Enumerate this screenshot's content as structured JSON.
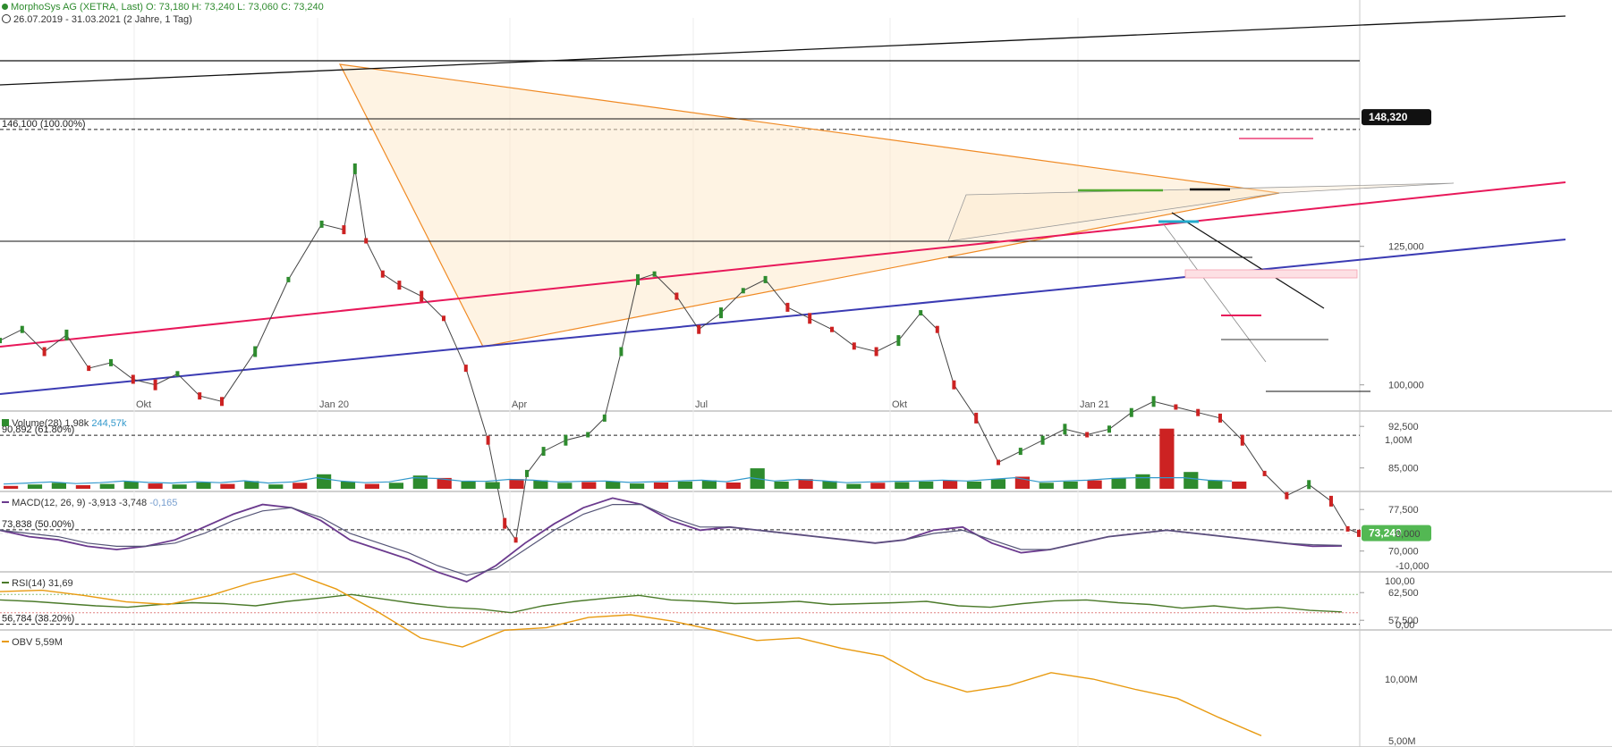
{
  "header": {
    "title_line": "MorphoSys AG (XETRA, Last)  O: 73,180  H: 73,240  L: 73,060  C: 73,240",
    "range_line": "26.07.2019 - 31.03.2021  (2 Jahre, 1 Tag)"
  },
  "colors": {
    "up": "#2e8b2e",
    "down": "#cc2222",
    "orange": "#f08a24",
    "pink": "#e8185a",
    "blue": "#3b3bb3",
    "macd": "#6b3a8e",
    "signal": "#555577",
    "rsi": "#4b7a2a",
    "obv": "#e89a10",
    "volume_ma": "#3399cc",
    "badge_price": "#53b853",
    "badge_dark": "#111111"
  },
  "chart_data": [
    {
      "type": "line",
      "title": "MorphoSys AG (XETRA, Last)",
      "x_ticks": [
        "Okt",
        "Jan 20",
        "Apr",
        "Jul",
        "Okt",
        "Jan 21"
      ],
      "y_ticks": [
        "125,000",
        "100,000",
        "92,500",
        "85,000",
        "77,500",
        "70,000",
        "62,500",
        "57,500"
      ],
      "ylim": [
        55,
        150
      ],
      "fib_levels": [
        {
          "label": "146,100 (100.00%)",
          "value": 146.1
        },
        {
          "label": "90,892 (61.80%)",
          "value": 90.892
        },
        {
          "label": "73,838 (50.00%)",
          "value": 73.838
        },
        {
          "label": "56,784 (38.20%)",
          "value": 56.784
        }
      ],
      "price_badges": [
        {
          "label": "148,320",
          "value": 148.32
        },
        {
          "label": "73,240",
          "value": 73.24
        }
      ],
      "series": [
        {
          "name": "Close",
          "x": [
            0,
            20,
            40,
            60,
            80,
            100,
            120,
            140,
            160,
            180,
            200,
            230,
            260,
            290,
            310,
            320,
            330,
            345,
            360,
            380,
            400,
            420,
            440,
            455,
            465,
            475,
            490,
            510,
            530,
            545,
            560,
            575,
            590,
            610,
            630,
            650,
            670,
            690,
            710,
            730,
            750,
            770,
            790,
            810,
            830,
            845,
            860,
            880,
            900,
            920,
            940,
            960,
            980,
            1000,
            1020,
            1040,
            1060,
            1080,
            1100,
            1120,
            1140,
            1160,
            1180,
            1200,
            1215,
            1225
          ],
          "y": [
            108,
            110,
            106,
            109,
            103,
            104,
            101,
            100,
            102,
            98,
            97,
            106,
            119,
            129,
            128,
            139,
            126,
            120,
            118,
            116,
            112,
            103,
            90,
            75,
            72,
            84,
            88,
            90,
            91,
            94,
            106,
            119,
            120,
            116,
            110,
            113,
            117,
            119,
            114,
            112,
            110,
            107,
            106,
            108,
            113,
            110,
            100,
            94,
            86,
            88,
            90,
            92,
            91,
            92,
            95,
            97,
            96,
            95,
            94,
            90,
            84,
            80,
            82,
            79,
            74,
            73.2
          ]
        }
      ]
    },
    {
      "type": "bar",
      "title": "Volume(28)",
      "legend": "1,98k",
      "ma_value": "244,57k",
      "y_ticks": [
        "1,00M"
      ],
      "values": [
        0.12,
        0.18,
        0.25,
        0.15,
        0.2,
        0.3,
        0.22,
        0.18,
        0.26,
        0.2,
        0.32,
        0.18,
        0.25,
        0.6,
        0.3,
        0.2,
        0.25,
        0.55,
        0.45,
        0.3,
        0.28,
        0.4,
        0.35,
        0.25,
        0.28,
        0.3,
        0.22,
        0.26,
        0.3,
        0.35,
        0.26,
        0.85,
        0.3,
        0.4,
        0.32,
        0.2,
        0.25,
        0.28,
        0.3,
        0.35,
        0.3,
        0.4,
        0.5,
        0.25,
        0.3,
        0.35,
        0.45,
        0.6,
        2.5,
        0.7,
        0.35,
        0.3
      ]
    },
    {
      "type": "line",
      "title": "MACD(12, 26, 9)",
      "legend_values": [
        "-3,913",
        "-3,748",
        "-0,165"
      ],
      "y_ticks": [
        "0,000",
        "-10,000"
      ],
      "series": [
        {
          "name": "MACD",
          "values": [
            1,
            -1,
            -2,
            -4,
            -5,
            -4,
            -2,
            2,
            6,
            9,
            8,
            4,
            -2,
            -5,
            -8,
            -12,
            -15,
            -10,
            -3,
            3,
            8,
            11,
            9,
            4,
            1,
            2,
            1,
            0,
            -1,
            -2,
            -3,
            -2,
            1,
            2,
            -3,
            -6,
            -5,
            -3,
            -1,
            0,
            1,
            0,
            -1,
            -2,
            -3,
            -4,
            -3.9
          ]
        },
        {
          "name": "Signal",
          "values": [
            1,
            0,
            -1,
            -3,
            -4,
            -4,
            -3,
            0,
            4,
            7,
            8,
            5,
            0,
            -3,
            -6,
            -10,
            -13,
            -11,
            -5,
            1,
            6,
            9,
            9,
            5,
            2,
            2,
            1,
            0,
            -1,
            -2,
            -3,
            -2,
            0,
            1,
            -2,
            -5,
            -5,
            -3,
            -1,
            0,
            1,
            0,
            -1,
            -2,
            -3,
            -3.5,
            -3.7
          ]
        }
      ]
    },
    {
      "type": "line",
      "title": "RSI(14)",
      "legend": "31,69",
      "y_ticks": [
        "100,00",
        "0,00"
      ],
      "values": [
        58,
        55,
        50,
        45,
        42,
        48,
        52,
        50,
        45,
        55,
        62,
        70,
        60,
        50,
        42,
        38,
        30,
        45,
        55,
        62,
        68,
        58,
        55,
        50,
        52,
        55,
        48,
        50,
        52,
        55,
        45,
        42,
        50,
        56,
        58,
        52,
        48,
        40,
        45,
        38,
        42,
        35,
        31.7
      ]
    },
    {
      "type": "line",
      "title": "OBV",
      "legend": "5,59M",
      "y_ticks": [
        "10,00M",
        "5,00M"
      ],
      "values": [
        16.8,
        16.9,
        16.5,
        16.0,
        15.8,
        16.5,
        17.5,
        18.2,
        17.0,
        15.2,
        13.2,
        12.5,
        13.8,
        14.0,
        14.8,
        15.0,
        14.5,
        13.8,
        13.0,
        13.2,
        12.4,
        11.8,
        10.0,
        9.0,
        9.5,
        10.5,
        10.0,
        9.2,
        8.5,
        7.0,
        5.6
      ]
    }
  ]
}
